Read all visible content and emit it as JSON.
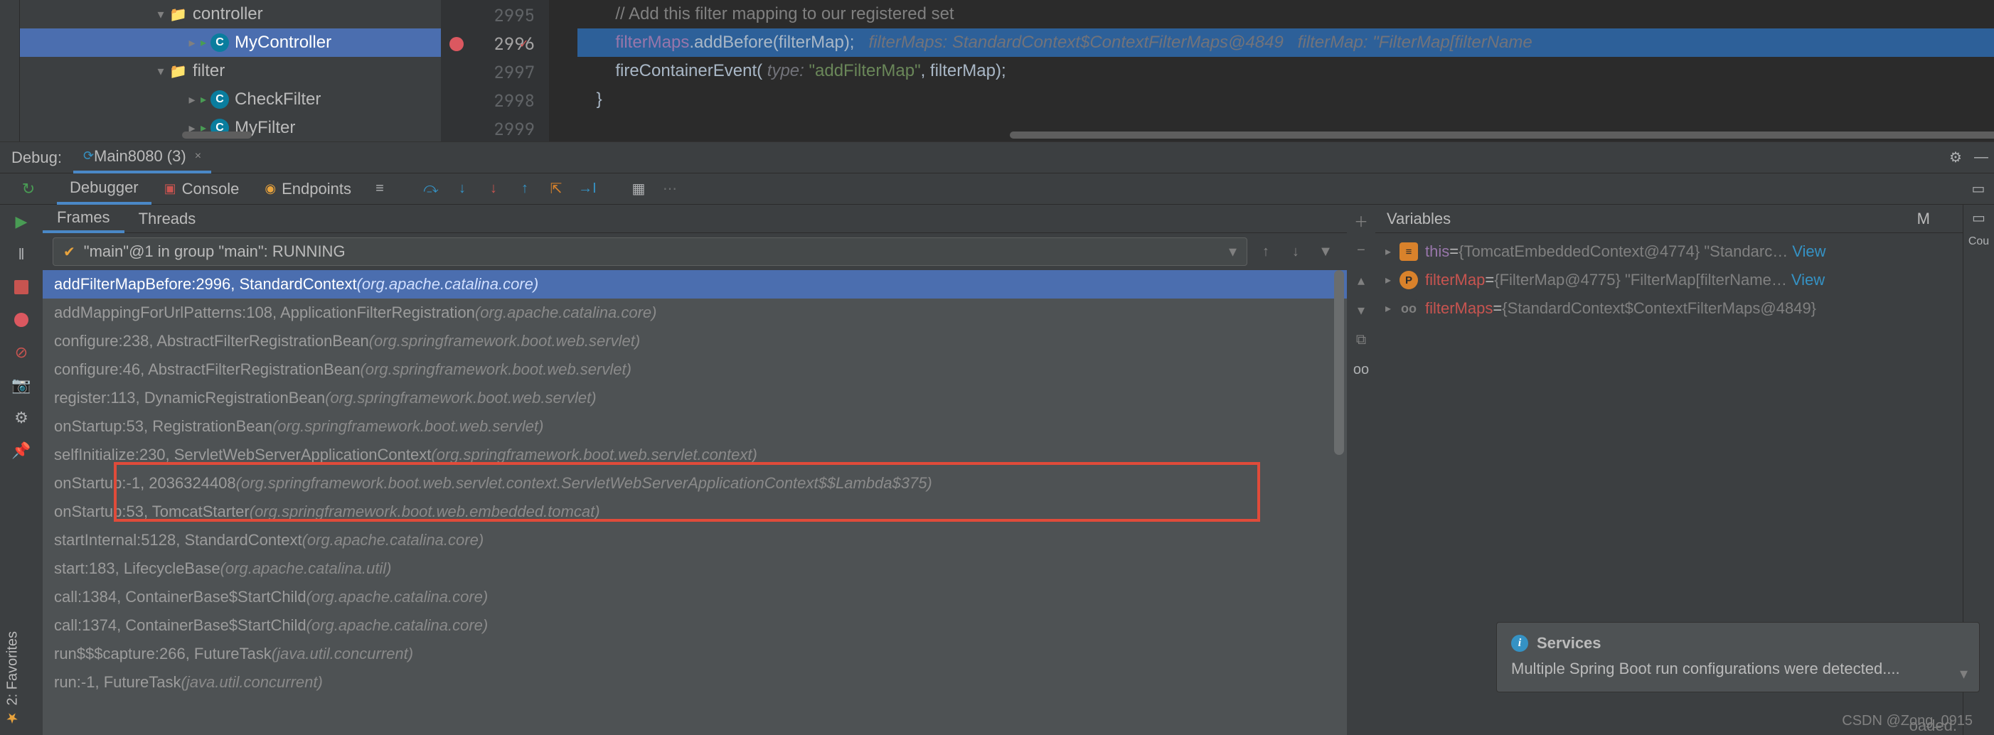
{
  "tree": {
    "items": [
      {
        "indent": 190,
        "tri": "▾",
        "icon": "folder",
        "label": "controller"
      },
      {
        "indent": 234,
        "tri": "▸",
        "play": true,
        "icon": "class",
        "letter": "C",
        "label": "MyController",
        "selected": true
      },
      {
        "indent": 190,
        "tri": "▾",
        "icon": "folder",
        "label": "filter"
      },
      {
        "indent": 234,
        "tri": "▸",
        "play": true,
        "icon": "class",
        "letter": "C",
        "label": "CheckFilter"
      },
      {
        "indent": 234,
        "tri": "▸",
        "play": true,
        "icon": "class",
        "letter": "C",
        "label": "MyFilter"
      }
    ]
  },
  "editor": {
    "lines": [
      {
        "num": "2995",
        "segments": [
          {
            "cls": "cm-comment",
            "text": "        // Add this filter mapping to our registered set"
          }
        ]
      },
      {
        "num": "2996",
        "current": true,
        "bp": true,
        "mark": true,
        "exec": true,
        "segments": [
          {
            "cls": "cm-ident",
            "text": "        "
          },
          {
            "cls": "cm-field",
            "text": "filterMaps"
          },
          {
            "cls": "cm-ident",
            "text": ".addBefore(filterMap);   "
          },
          {
            "cls": "cm-hint",
            "text": "filterMaps: StandardContext$ContextFilterMaps@4849   filterMap: \"FilterMap[filterName"
          }
        ]
      },
      {
        "num": "2997",
        "segments": [
          {
            "cls": "cm-ident",
            "text": "        fireContainerEvent( "
          },
          {
            "cls": "cm-inlay",
            "text": "type: "
          },
          {
            "cls": "cm-str",
            "text": "\"addFilterMap\""
          },
          {
            "cls": "cm-ident",
            "text": ", filterMap);"
          }
        ]
      },
      {
        "num": "2998",
        "segments": [
          {
            "cls": "cm-ident",
            "text": "    }"
          }
        ]
      },
      {
        "num": "2999",
        "segments": [
          {
            "cls": "cm-ident",
            "text": ""
          }
        ]
      }
    ]
  },
  "debug": {
    "label": "Debug:",
    "run_tab": "Main8080 (3)",
    "tabs": {
      "debugger": "Debugger",
      "console": "Console",
      "endpoints": "Endpoints"
    },
    "frame_tabs": {
      "frames": "Frames",
      "threads": "Threads"
    },
    "thread_selector": "\"main\"@1 in group \"main\": RUNNING",
    "frames": [
      {
        "main": "addFilterMapBefore:2996, StandardContext ",
        "pkg": "(org.apache.catalina.core)",
        "selected": true
      },
      {
        "main": "addMappingForUrlPatterns:108, ApplicationFilterRegistration ",
        "pkg": "(org.apache.catalina.core)"
      },
      {
        "main": "configure:238, AbstractFilterRegistrationBean ",
        "pkg": "(org.springframework.boot.web.servlet)"
      },
      {
        "main": "configure:46, AbstractFilterRegistrationBean ",
        "pkg": "(org.springframework.boot.web.servlet)"
      },
      {
        "main": "register:113, DynamicRegistrationBean ",
        "pkg": "(org.springframework.boot.web.servlet)"
      },
      {
        "main": "onStartup:53, RegistrationBean ",
        "pkg": "(org.springframework.boot.web.servlet)"
      },
      {
        "main": "selfInitialize:230, ServletWebServerApplicationContext ",
        "pkg": "(org.springframework.boot.web.servlet.context)"
      },
      {
        "main": "onStartup:-1, 2036324408 ",
        "pkg": "(org.springframework.boot.web.servlet.context.ServletWebServerApplicationContext$$Lambda$375)"
      },
      {
        "main": "onStartup:53, TomcatStarter ",
        "pkg": "(org.springframework.boot.web.embedded.tomcat)"
      },
      {
        "main": "startInternal:5128, StandardContext ",
        "pkg": "(org.apache.catalina.core)"
      },
      {
        "main": "start:183, LifecycleBase ",
        "pkg": "(org.apache.catalina.util)"
      },
      {
        "main": "call:1384, ContainerBase$StartChild ",
        "pkg": "(org.apache.catalina.core)"
      },
      {
        "main": "call:1374, ContainerBase$StartChild ",
        "pkg": "(org.apache.catalina.core)"
      },
      {
        "main": "run$$$capture:266, FutureTask ",
        "pkg": "(java.util.concurrent)"
      },
      {
        "main": "run:-1, FutureTask ",
        "pkg": "(java.util.concurrent)"
      }
    ],
    "vars_header": {
      "label": "Variables",
      "m": "M",
      "cou": "Cou"
    },
    "variables": [
      {
        "tri": "▸",
        "ic": "this",
        "icText": "≡",
        "name": "this",
        "eq": " = ",
        "val": "{TomcatEmbeddedContext@4774} \"Standarc…",
        "view": "View"
      },
      {
        "tri": "▸",
        "ic": "p",
        "icText": "P",
        "name": "filterMap",
        "nameRed": true,
        "eq": " = ",
        "val": "{FilterMap@4775} \"FilterMap[filterName…",
        "view": "View"
      },
      {
        "tri": "▸",
        "ic": "oo",
        "icText": "oo",
        "name": "filterMaps",
        "nameRed": true,
        "eq": " = ",
        "val": "{StandardContext$ContextFilterMaps@4849}",
        "view": ""
      }
    ],
    "loaded_hint": "oaded."
  },
  "notif": {
    "title": "Services",
    "body": "Multiple Spring Boot run configurations were detected...."
  },
  "watermark": "CSDN @Zong_0915",
  "favorites": "2: Favorites"
}
